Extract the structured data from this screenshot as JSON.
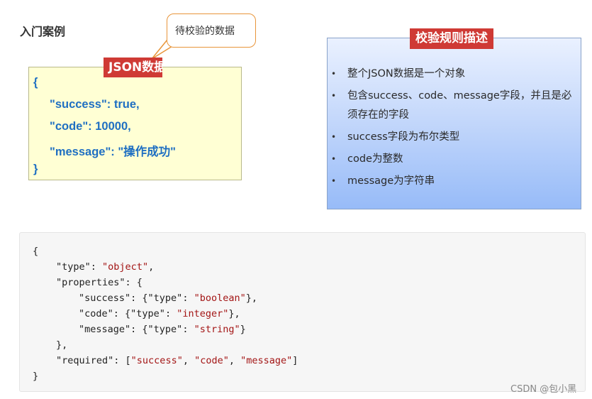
{
  "title": "入门案例",
  "bubble_text": "待校验的数据",
  "json_tag": "JSON数据",
  "json_lines": [
    "{",
    "\"success\": true,",
    "\"code\": 10000,",
    "\"message\": \"操作成功\"",
    "}"
  ],
  "rule_tag": "校验规则描述",
  "rules": [
    "整个JSON数据是一个对象",
    "包含success、code、message字段，并且是必须存在的字段",
    "success字段为布尔类型",
    "code为整数",
    "message为字符串"
  ],
  "code": {
    "open": "{",
    "type_key": "\"type\"",
    "type_val": "\"object\"",
    "properties_key": "\"properties\"",
    "success_key": "\"success\"",
    "code_key": "\"code\"",
    "message_key": "\"message\"",
    "inner_type_key": "\"type\"",
    "boolean_val": "\"boolean\"",
    "integer_val": "\"integer\"",
    "string_val": "\"string\"",
    "props_close": "},",
    "required_key": "\"required\"",
    "req_success": "\"success\"",
    "req_code": "\"code\"",
    "req_message": "\"message\"",
    "close": "}"
  },
  "watermark": "CSDN @包小黑",
  "colors": {
    "tag_red": "#cf3a35",
    "json_blue": "#1f6fc2",
    "bubble_orange": "#e8953a",
    "string_red": "#a31515"
  }
}
